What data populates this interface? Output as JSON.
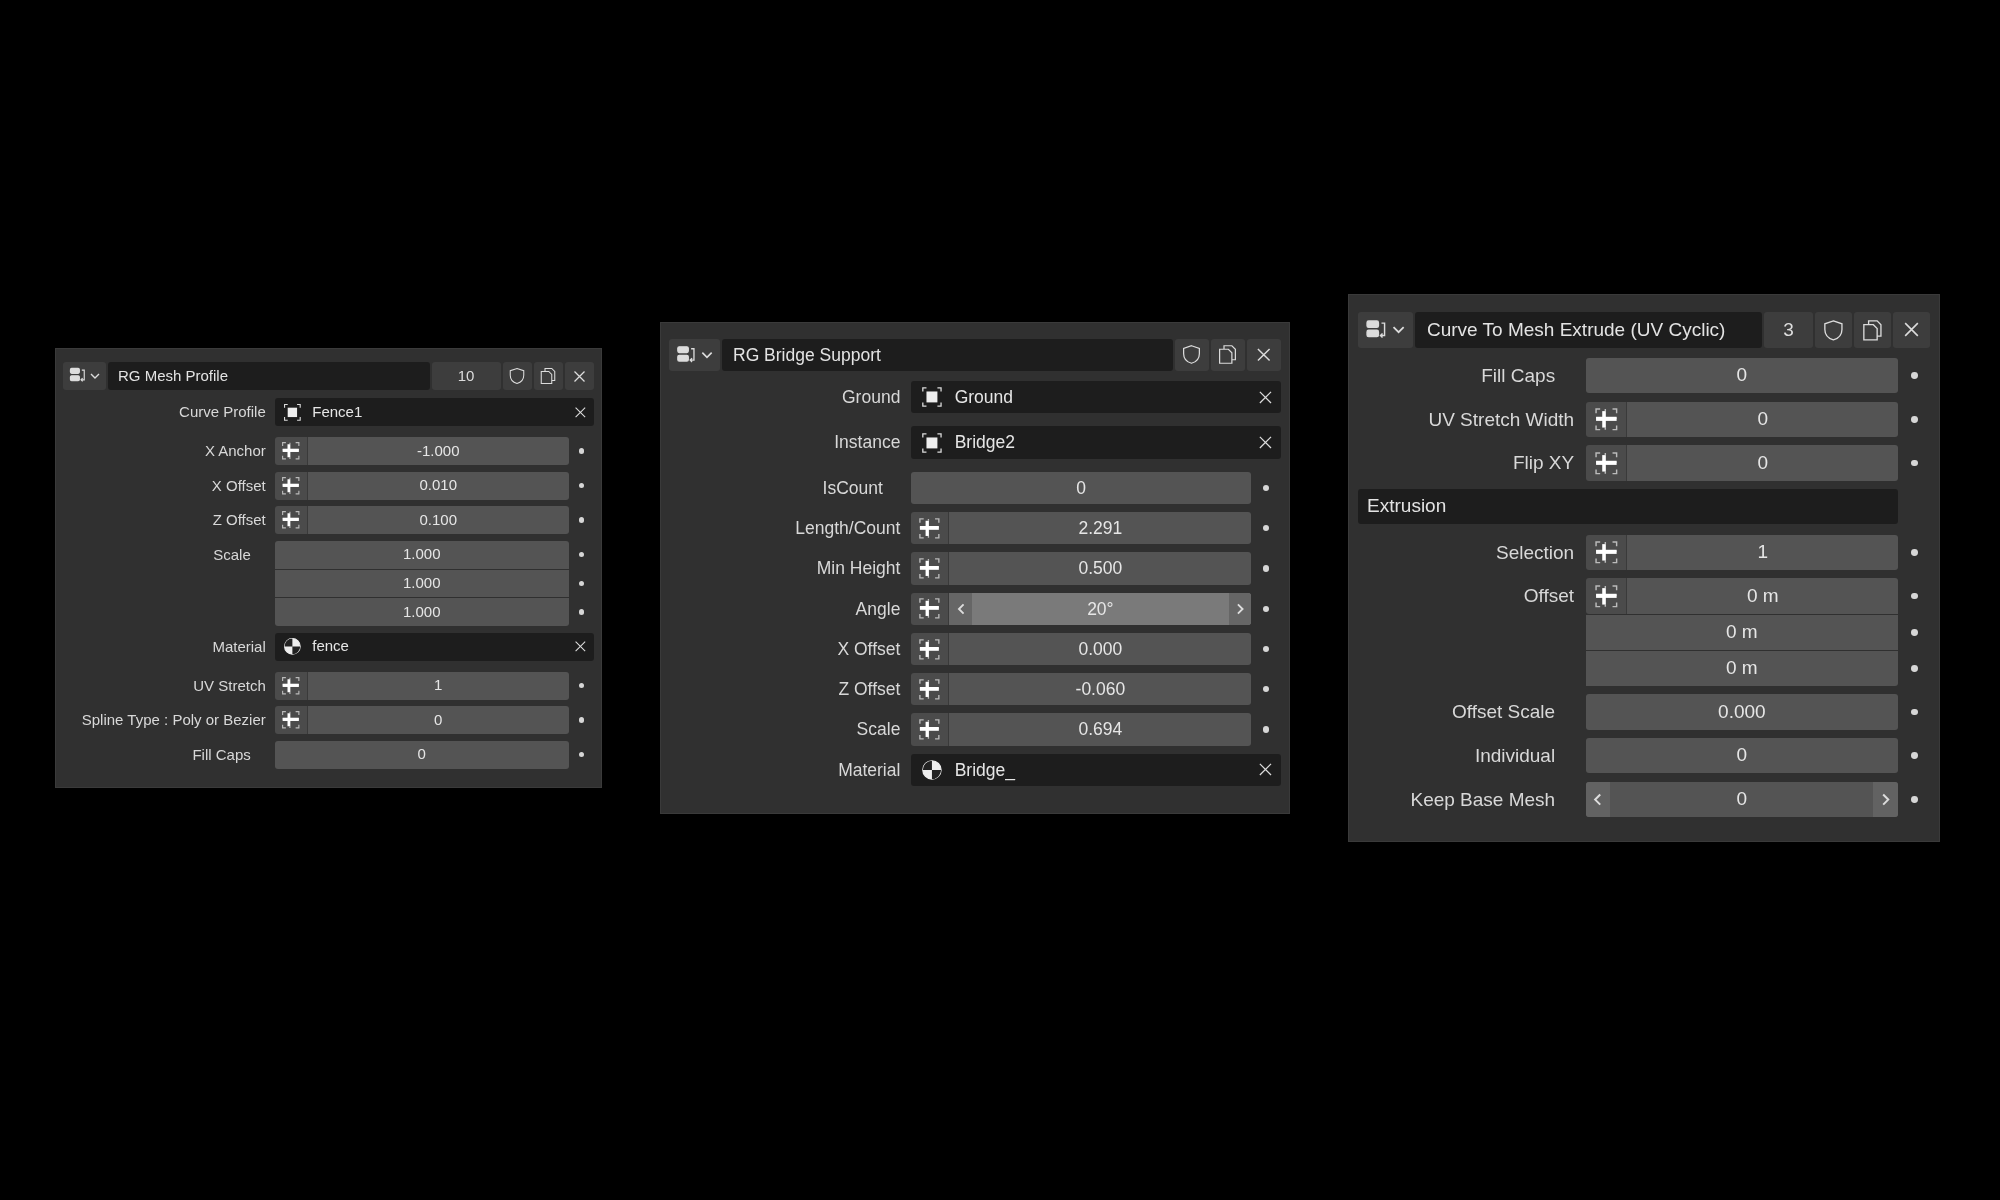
{
  "panels": [
    {
      "title": "RG Mesh Profile",
      "count": "10",
      "rows": [
        {
          "kind": "object",
          "label": "Curve Profile",
          "value": "Fence1"
        },
        {
          "kind": "number",
          "label": "X Anchor",
          "toggle": true,
          "values": [
            "-1.000"
          ]
        },
        {
          "kind": "number",
          "label": "X Offset",
          "toggle": true,
          "values": [
            "0.010"
          ]
        },
        {
          "kind": "number",
          "label": "Z Offset",
          "toggle": true,
          "values": [
            "0.100"
          ]
        },
        {
          "kind": "number",
          "label": "Scale",
          "toggle": false,
          "values": [
            "1.000",
            "1.000",
            "1.000"
          ]
        },
        {
          "kind": "material",
          "label": "Material",
          "value": "fence"
        },
        {
          "kind": "number",
          "label": "UV Stretch",
          "toggle": true,
          "values": [
            "1"
          ]
        },
        {
          "kind": "number",
          "label": "Spline Type : Poly or Bezier",
          "toggle": true,
          "values": [
            "0"
          ]
        },
        {
          "kind": "number",
          "label": "Fill Caps",
          "toggle": false,
          "values": [
            "0"
          ]
        }
      ]
    },
    {
      "title": "RG Bridge Support",
      "rows": [
        {
          "kind": "object",
          "label": "Ground",
          "value": "Ground"
        },
        {
          "kind": "object",
          "label": "Instance",
          "value": "Bridge2"
        },
        {
          "kind": "number",
          "label": "IsCount",
          "toggle": false,
          "values": [
            "0"
          ]
        },
        {
          "kind": "number",
          "label": "Length/Count",
          "toggle": true,
          "values": [
            "2.291"
          ]
        },
        {
          "kind": "number",
          "label": "Min Height",
          "toggle": true,
          "values": [
            "0.500"
          ]
        },
        {
          "kind": "slider",
          "label": "Angle",
          "toggle": true,
          "hovered": true,
          "values": [
            "20°"
          ]
        },
        {
          "kind": "number",
          "label": "X Offset",
          "toggle": true,
          "values": [
            "0.000"
          ]
        },
        {
          "kind": "number",
          "label": "Z Offset",
          "toggle": true,
          "values": [
            "-0.060"
          ]
        },
        {
          "kind": "number",
          "label": "Scale",
          "toggle": true,
          "values": [
            "0.694"
          ]
        },
        {
          "kind": "material",
          "label": "Material",
          "value": "Bridge_"
        }
      ]
    },
    {
      "title": "Curve To Mesh Extrude (UV Cyclic)",
      "count": "3",
      "rows": [
        {
          "kind": "number",
          "label": "Fill Caps",
          "toggle": false,
          "values": [
            "0"
          ]
        },
        {
          "kind": "number",
          "label": "UV Stretch Width",
          "toggle": true,
          "values": [
            "0"
          ]
        },
        {
          "kind": "number",
          "label": "Flip XY",
          "toggle": true,
          "values": [
            "0"
          ]
        },
        {
          "kind": "header",
          "label": "Extrusion"
        },
        {
          "kind": "number",
          "label": "Selection",
          "toggle": true,
          "values": [
            "1"
          ]
        },
        {
          "kind": "number",
          "label": "Offset",
          "toggle": true,
          "values": [
            "0 m",
            "0 m",
            "0 m"
          ]
        },
        {
          "kind": "number",
          "label": "Offset Scale",
          "toggle": false,
          "values": [
            "0.000"
          ]
        },
        {
          "kind": "number",
          "label": "Individual",
          "toggle": false,
          "values": [
            "0"
          ]
        },
        {
          "kind": "slider",
          "label": "Keep Base Mesh",
          "toggle": false,
          "hovered": false,
          "values": [
            "0"
          ]
        }
      ]
    }
  ]
}
